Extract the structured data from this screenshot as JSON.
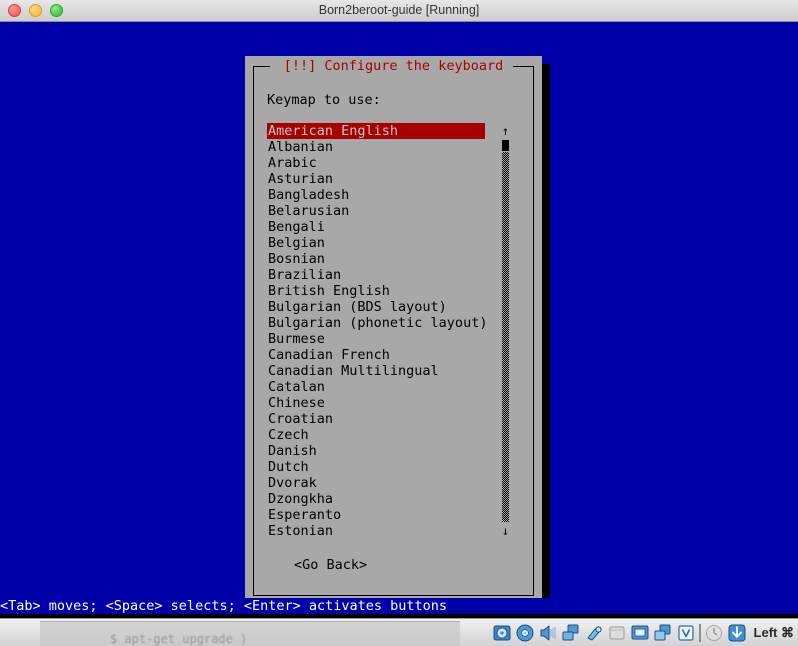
{
  "window": {
    "title": "Born2beroot-guide [Running]",
    "controls": [
      "close",
      "minimize",
      "zoom"
    ]
  },
  "dialog": {
    "title": "[!!] Configure the keyboard",
    "prompt": "Keymap to use:",
    "title_color": "#aa0000",
    "background_color": "#a8a8a8",
    "selection_color": "#a80000",
    "selected_index": 0,
    "items": [
      "American English",
      "Albanian",
      "Arabic",
      "Asturian",
      "Bangladesh",
      "Belarusian",
      "Bengali",
      "Belgian",
      "Bosnian",
      "Brazilian",
      "British English",
      "Bulgarian (BDS layout)",
      "Bulgarian (phonetic layout)",
      "Burmese",
      "Canadian French",
      "Canadian Multilingual",
      "Catalan",
      "Chinese",
      "Croatian",
      "Czech",
      "Danish",
      "Dutch",
      "Dvorak",
      "Dzongkha",
      "Esperanto",
      "Estonian"
    ],
    "scrollbar": {
      "up_arrow": "↑",
      "down_arrow": "↓"
    },
    "go_back_button": "<Go Back>"
  },
  "console": {
    "hint": "<Tab> moves; <Space> selects; <Enter> activates buttons",
    "background_color": "#0000a8",
    "text_color": "#ffffff"
  },
  "background_window": {
    "text": "$ apt-get upgrade )"
  },
  "statusbar": {
    "host_key": "Left ⌘",
    "icons": [
      "hard-disk-icon",
      "optical-disk-icon",
      "audio-icon",
      "network-icon",
      "usb-icon",
      "shared-folders-icon",
      "display-icon",
      "remote-desktop-icon",
      "recording-icon",
      "mouse-integration-icon",
      "host-key-icon"
    ]
  }
}
